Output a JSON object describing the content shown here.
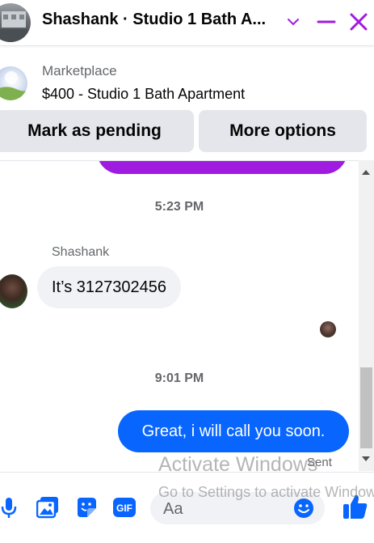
{
  "header": {
    "title": "Shashank · Studio 1 Bath A...",
    "icons": [
      "chevron-down-icon",
      "minimize-icon",
      "close-icon"
    ],
    "accent_color": "#a01be0"
  },
  "marketplace": {
    "label": "Marketplace",
    "listing": "$400 - Studio 1 Bath Apartment"
  },
  "actions": {
    "mark_pending": "Mark as pending",
    "more_options": "More options"
  },
  "chat": {
    "time_1": "5:23 PM",
    "sender": "Shashank",
    "incoming_message": "It’s 3127302456",
    "time_2": "9:01 PM",
    "outgoing_message": "Great, i will call you soon.",
    "status": "Sent"
  },
  "composer": {
    "placeholder": "Aa",
    "icons": [
      "microphone-icon",
      "image-icon",
      "sticker-icon",
      "gif-icon",
      "emoji-icon",
      "thumbs-up-icon"
    ]
  },
  "watermark": {
    "line1": "Activate Windows",
    "line2": "Go to Settings to activate Windows."
  },
  "colors": {
    "blue": "#0866ff",
    "purple": "#a01be0",
    "gray_bubble": "#f0f2f5"
  }
}
